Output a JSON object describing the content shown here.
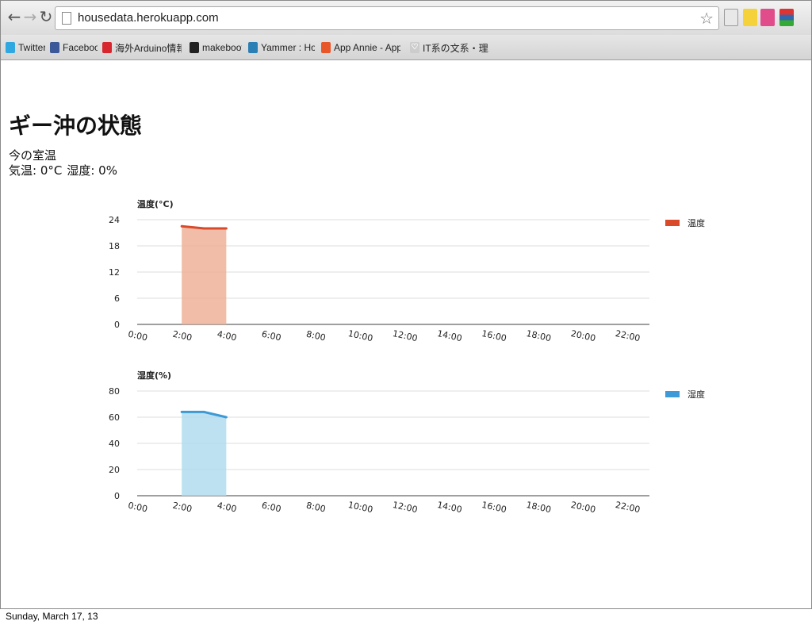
{
  "browser": {
    "back_icon": "back-arrow-icon",
    "forward_icon": "forward-arrow-icon",
    "reload_icon": "reload-icon",
    "url": "housedata.herokuapp.com",
    "bookmarks": [
      {
        "label": "Twitter",
        "icon": "twitter-icon",
        "color": "#2fa7e0"
      },
      {
        "label": "Facebook",
        "icon": "facebook-icon",
        "color": "#3b5998"
      },
      {
        "label": "海外Arduino情報 | Di",
        "icon": "arduino-a-icon",
        "color": "#d8262f"
      },
      {
        "label": "makebooth",
        "icon": "makebooth-icon",
        "color": "#222222"
      },
      {
        "label": "Yammer : Home",
        "icon": "yammer-icon",
        "color": "#2a7fb5"
      },
      {
        "label": "App Annie - App Ra",
        "icon": "app-annie-icon",
        "color": "#e8572a"
      },
      {
        "label": "IT系の文系・理系学生",
        "icon": "heart-icon",
        "color": "#bbbbbb"
      }
    ]
  },
  "page": {
    "title": "ギー沖の状態",
    "room_heading": "今の室温",
    "temp_label": "気温: 0°C",
    "humidity_label": "湿度: 0%"
  },
  "colors": {
    "temperature_line": "#d94a2b",
    "temperature_fill": "#eeb199",
    "humidity_line": "#3e9ad6",
    "humidity_fill": "#b1dcef"
  },
  "chart_data": [
    {
      "type": "area",
      "title": "温度(°C)",
      "x_ticks": [
        "0:00",
        "2:00",
        "4:00",
        "6:00",
        "8:00",
        "10:00",
        "12:00",
        "14:00",
        "16:00",
        "18:00",
        "20:00",
        "22:00"
      ],
      "x_range": [
        0,
        23
      ],
      "ylim": [
        0,
        24
      ],
      "y_ticks": [
        0,
        6,
        12,
        18,
        24
      ],
      "grid": true,
      "legend": "right",
      "series": [
        {
          "name": "温度",
          "x": [
            2.0,
            3.0,
            4.0
          ],
          "y": [
            22.5,
            22.0,
            22.0
          ]
        }
      ]
    },
    {
      "type": "area",
      "title": "湿度(%)",
      "x_ticks": [
        "0:00",
        "2:00",
        "4:00",
        "6:00",
        "8:00",
        "10:00",
        "12:00",
        "14:00",
        "16:00",
        "18:00",
        "20:00",
        "22:00"
      ],
      "x_range": [
        0,
        23
      ],
      "ylim": [
        0,
        80
      ],
      "y_ticks": [
        0,
        20,
        40,
        60,
        80
      ],
      "grid": true,
      "legend": "right",
      "series": [
        {
          "name": "湿度",
          "x": [
            2.0,
            3.0,
            4.0
          ],
          "y": [
            64,
            64,
            60
          ]
        }
      ]
    }
  ],
  "footer": {
    "date": "Sunday, March 17, 13"
  }
}
